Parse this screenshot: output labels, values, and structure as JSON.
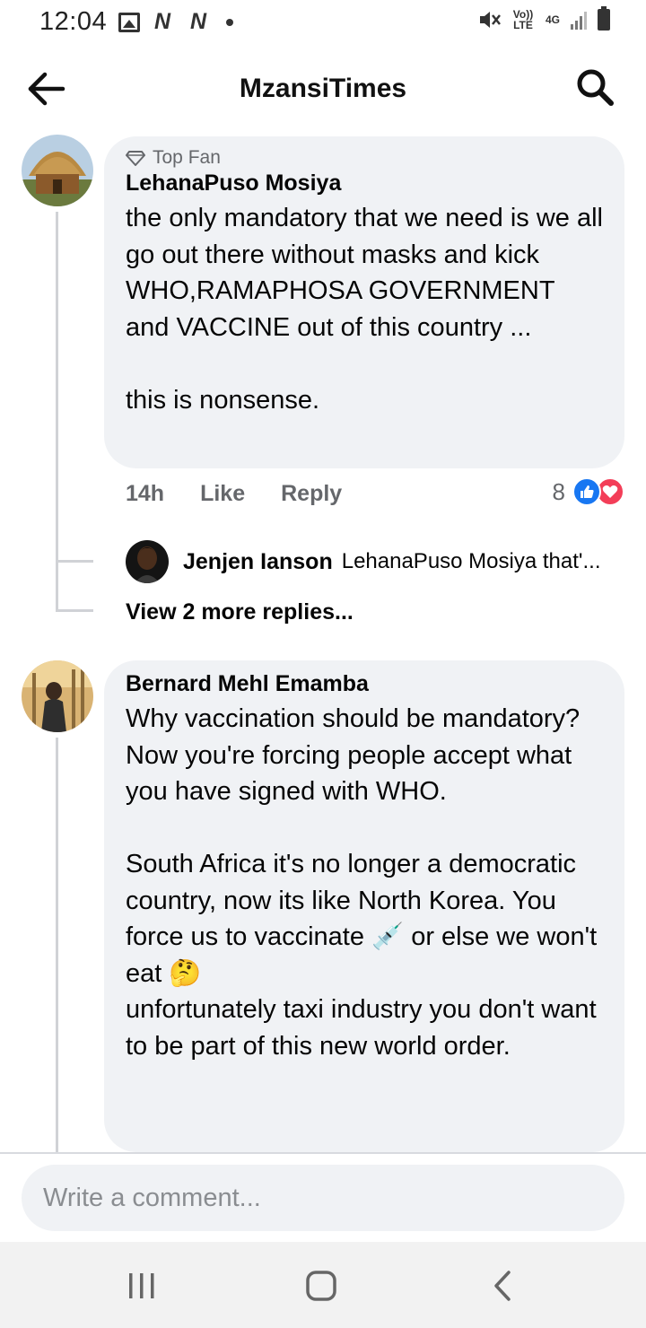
{
  "status_bar": {
    "time": "12:04",
    "volte_label": "Vo)) LTE",
    "network_label": "4G"
  },
  "header": {
    "title": "MzansiTimes",
    "back_icon": "arrow-left-icon",
    "search_icon": "search-icon"
  },
  "comments": [
    {
      "badge": "Top Fan",
      "author": "LehanaPuso Mosiya",
      "text": "the only mandatory that we need is we all go out there without masks and kick WHO,RAMAPHOSA GOVERNMENT and VACCINE out of this country ...\n\nthis is nonsense.",
      "time": "14h",
      "like_label": "Like",
      "reply_label": "Reply",
      "reaction_count": "8",
      "reply_preview": {
        "author": "Jenjen Ianson",
        "text": "LehanaPuso Mosiya that'..."
      },
      "view_more_label": "View 2 more replies..."
    },
    {
      "author": "Bernard Mehl Emamba",
      "text_part1": "Why vaccination should be mandatory? Now you're forcing people accept what you have signed with WHO.\n\nSouth Africa it's no longer a democratic country, now its like North Korea. You force us to vaccinate ",
      "emoji_syringe": "💉",
      "text_part2": " or else we won't eat ",
      "emoji_thinking": "🤔",
      "text_part3": "\nunfortunately taxi industry you don't want to be part of this new world order."
    }
  ],
  "composer": {
    "placeholder": "Write a comment..."
  },
  "colors": {
    "bubble_bg": "#f0f2f5",
    "like_blue": "#1877f2",
    "love_red": "#f33e58",
    "muted_text": "#65676b"
  }
}
